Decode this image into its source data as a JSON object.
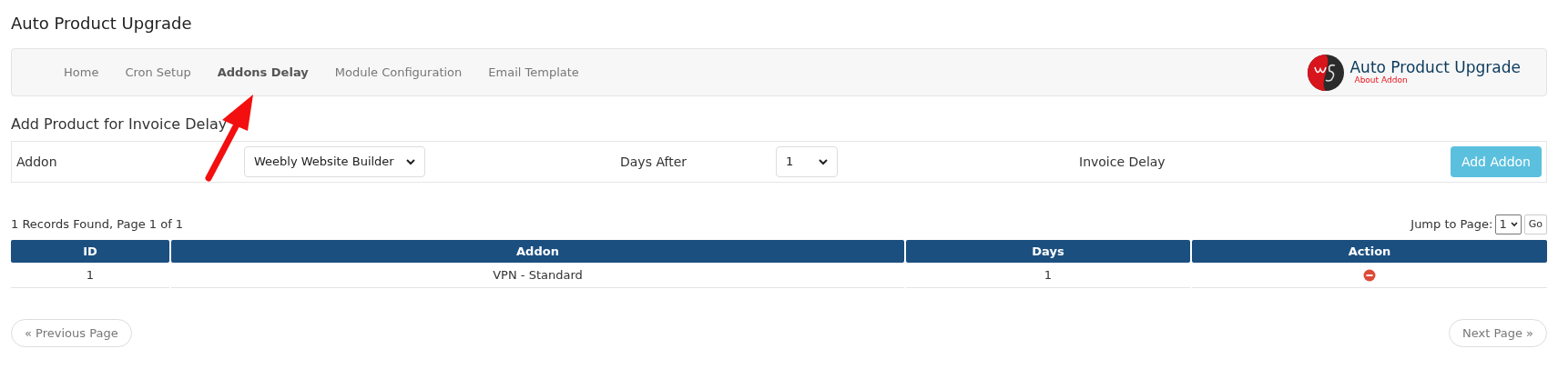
{
  "page_title": "Auto Product Upgrade",
  "nav": {
    "tabs": [
      {
        "label": "Home",
        "selected": false
      },
      {
        "label": "Cron Setup",
        "selected": false
      },
      {
        "label": "Addons Delay",
        "selected": true
      },
      {
        "label": "Module Configuration",
        "selected": false
      },
      {
        "label": "Email Template",
        "selected": false
      }
    ],
    "brand": {
      "title": "Auto Product Upgrade",
      "link": "About Addon"
    }
  },
  "section_title": "Add Product for Invoice Delay",
  "form": {
    "addon_label": "Addon",
    "addon_value": "Weebly Website Builder",
    "days_label": "Days After",
    "days_value": "1",
    "delay_label": "Invoice Delay",
    "submit": "Add Addon"
  },
  "records_info": "1 Records Found, Page 1 of 1",
  "jump": {
    "label": "Jump to Page:",
    "value": "1",
    "go": "Go"
  },
  "table": {
    "columns": [
      "ID",
      "Addon",
      "Days",
      "Action"
    ],
    "rows": [
      {
        "id": "1",
        "addon": "VPN - Standard",
        "days": "1"
      }
    ]
  },
  "pager": {
    "previous": "« Previous Page",
    "next": "Next Page »"
  }
}
